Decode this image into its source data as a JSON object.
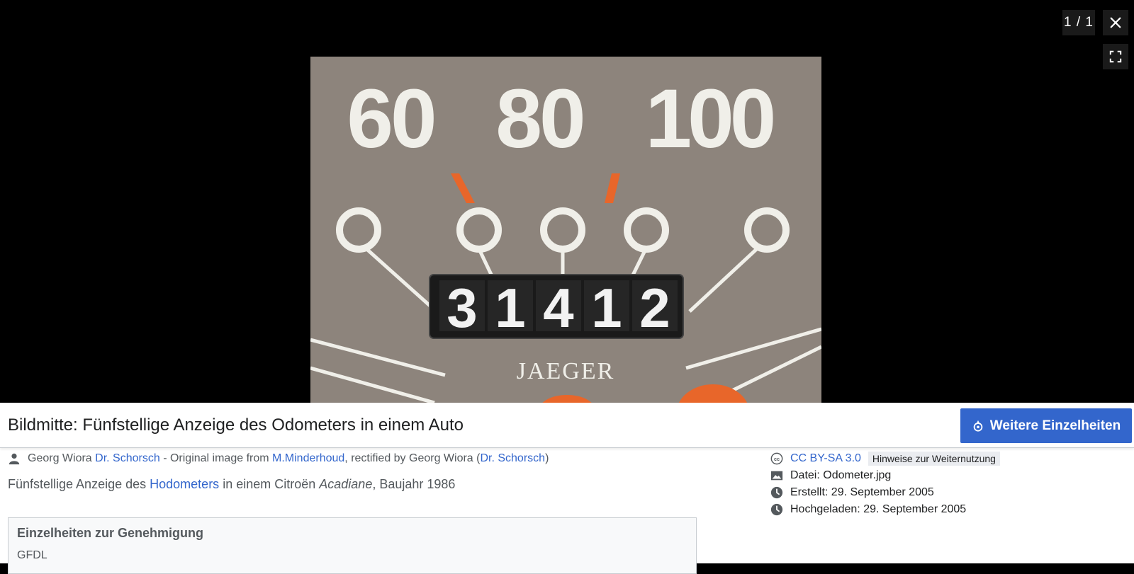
{
  "viewer": {
    "counter": "1 / 1",
    "photo": {
      "dial_numbers": [
        "60",
        "80",
        "100"
      ],
      "odometer_digits": [
        "3",
        "1",
        "4",
        "1",
        "2"
      ],
      "brand": "JAEGER"
    }
  },
  "info": {
    "title": "Bildmitte: Fünfstellige Anzeige des Odometers in einem Auto",
    "more_details_label": "Weitere Einzelheiten",
    "credit": {
      "author_text": "Georg Wiora",
      "author_link": "Dr. Schorsch",
      "mid_text": " - Original image from ",
      "source_link": "M.Minderhoud",
      "rectified_text": ", rectified by Georg Wiora (",
      "rectified_link": "Dr. Schorsch",
      "close_paren": ")"
    },
    "description": {
      "part1": "Fünfstellige Anzeige des ",
      "link": "Hodometers",
      "part2": " in einem Citroën ",
      "italic": "Acadiane",
      "part3": ", Baujahr 1986"
    },
    "permission": {
      "heading": "Einzelheiten zur Genehmigung",
      "text": "GFDL"
    },
    "meta": {
      "license": "CC BY-SA 3.0",
      "reuse_label": "Hinweise zur Weiternutzung",
      "file": "Datei: Odometer.jpg",
      "created": "Erstellt: 29. September 2005",
      "uploaded": "Hochgeladen: 29. September 2005"
    }
  },
  "colors": {
    "accent": "#3366cc",
    "dial_background": "#8d847c",
    "dial_marks": "#f0efe9",
    "orange": "#e8662a"
  }
}
